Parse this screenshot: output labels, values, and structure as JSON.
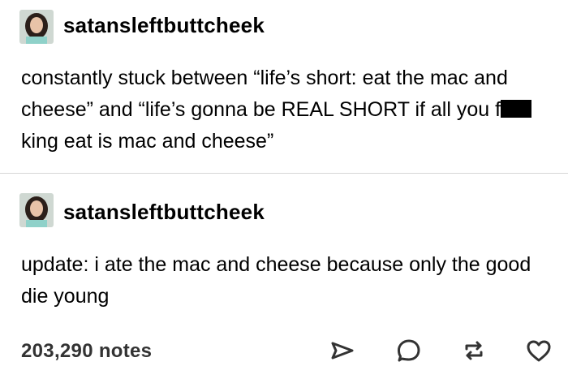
{
  "posts": [
    {
      "username": "satansleftbuttcheek",
      "text_before_censor": "constantly stuck between “life’s short: eat the mac and cheese” and “life’s gonna be REAL SHORT if all you f",
      "text_after_censor": "king eat is mac and cheese”"
    },
    {
      "username": "satansleftbuttcheek",
      "text": "update: i ate the mac and cheese because only the good die young"
    }
  ],
  "footer": {
    "notes": "203,290 notes",
    "actions": [
      "share-icon",
      "reply-icon",
      "reblog-icon",
      "like-icon"
    ]
  }
}
